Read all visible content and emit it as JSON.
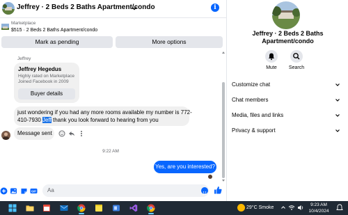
{
  "chat": {
    "title": "Jeffrey · 2 Beds 2 Baths Apartment/condo",
    "info_glyph": "i",
    "marketplace": {
      "label": "Marketplace",
      "listing": "$515 · 2 Beds 2 Baths Apartment/condo"
    },
    "buttons": {
      "mark_pending": "Mark as pending",
      "more_options": "More options"
    },
    "sender_name": "Jeffrey",
    "profile_card": {
      "name": "Jeffrey Hegedus",
      "line1": "Highly rated on Marketplace",
      "line2": "Joined Facebook in 2009",
      "button": "Buyer details"
    },
    "message": {
      "line1": "just wondering if you had any more rooms available my number is 772-",
      "line2_pre": "410-7930 ",
      "line2_highlight": "Jeff",
      "line2_post": " thank you look forward to hearing from you"
    },
    "status_message": "Message sent",
    "timestamp": "9:22 AM",
    "reply": "Yes, are you interested?",
    "composer_placeholder": "Aa"
  },
  "info": {
    "name": "Jeffrey · 2 Beds 2 Baths Apartment/condo",
    "actions": {
      "mute": "Mute",
      "search": "Search"
    },
    "menu": [
      "Customize chat",
      "Chat members",
      "Media, files and links",
      "Privacy & support"
    ]
  },
  "taskbar": {
    "weather": "29°C  Smoke",
    "time": "9:23 AM",
    "date": "10/4/2024"
  },
  "colors": {
    "accent": "#0866ff",
    "bubble_gray": "#f0f0f0",
    "button_gray": "#e4e6eb",
    "taskbar": "#202a35"
  }
}
